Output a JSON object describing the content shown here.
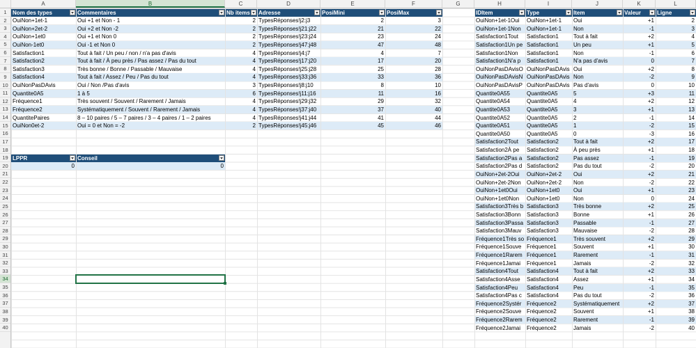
{
  "columns": [
    "A",
    "B",
    "C",
    "D",
    "E",
    "F",
    "G",
    "H",
    "I",
    "J",
    "K",
    "L"
  ],
  "rows": [
    "1",
    "2",
    "3",
    "4",
    "5",
    "6",
    "7",
    "8",
    "9",
    "10",
    "11",
    "12",
    "13",
    "14",
    "15",
    "16",
    "17",
    "18",
    "19",
    "20",
    "21",
    "22",
    "23",
    "24",
    "25",
    "26",
    "27",
    "28",
    "29",
    "30",
    "31",
    "32",
    "33",
    "34",
    "35",
    "36",
    "37",
    "38",
    "39",
    "40"
  ],
  "selected": {
    "column": "B",
    "row": "34"
  },
  "table1": {
    "headers": [
      "Nom des types",
      "Commentaires",
      "Nb items",
      "Adresse",
      "PosiMini",
      "PosiMax"
    ],
    "rows": [
      [
        "OuiNon+1et-1",
        "Oui +1 et Non - 1",
        "2",
        "TypesRéponses!j2:j3",
        "2",
        "3"
      ],
      [
        "OuiNon+2et-2",
        "Oui +2 et Non -2",
        "2",
        "TypesRéponses!j21:j22",
        "21",
        "22"
      ],
      [
        "OuiNon+1et0",
        "Oui +1 et Non 0",
        "2",
        "TypesRéponses!j23:j24",
        "23",
        "24"
      ],
      [
        "OuiNon-1et0",
        "Oui -1 et Non 0",
        "2",
        "TypesRéponses!j47:j48",
        "47",
        "48"
      ],
      [
        "Satisfaction1",
        "Tout à fait / Un  peu / non / n'a pas d'avis",
        "4",
        "TypesRéponses!j4:j7",
        "4",
        "7"
      ],
      [
        "Satisfaction2",
        "Tout à fait / À peu près / Pas assez / Pas du tout",
        "4",
        "TypesRéponses!j17:j20",
        "17",
        "20"
      ],
      [
        "Satisfaction3",
        "Très bonne / Bonne / Passable / Mauvaise",
        "4",
        "TypesRéponses!j25:j28",
        "25",
        "28"
      ],
      [
        "Satisfaction4",
        "Tout à fait / Assez / Peu / Pas du tout",
        "4",
        "TypesRéponses!j33:j36",
        "33",
        "36"
      ],
      [
        "OuiNonPasDAvis",
        "Oui / Non /Pas d'avis",
        "3",
        "TypesRéponses!j8:j10",
        "8",
        "10"
      ],
      [
        "Quantite0A5",
        "1 à 5",
        "6",
        "TypesRéponses!j11:j16",
        "11",
        "16"
      ],
      [
        "Fréquence1",
        "Très souvent / Souvent / Rarement / Jamais",
        "4",
        "TypesRéponses!j29:j32",
        "29",
        "32"
      ],
      [
        "Fréquence2",
        "Systématiquement / Souvent / Rarement / Jamais",
        "4",
        "TypesRéponses!j37:j40",
        "37",
        "40"
      ],
      [
        "QuantitePaires",
        "8 – 10 paires / 5 – 7 paires / 3 – 4 paires / 1 – 2 paires",
        "4",
        "TypesRéponses!j41:j44",
        "41",
        "44"
      ],
      [
        "OuiNon0et-2",
        "Oui = 0 et Non = -2",
        "2",
        "TypesRéponses!j45:j46",
        "45",
        "46"
      ]
    ]
  },
  "table2": {
    "headers": [
      "LPPR",
      "Conseil"
    ],
    "rows": [
      [
        "0",
        "0"
      ]
    ]
  },
  "table3": {
    "headers": [
      "IDItem",
      "Type",
      "Item",
      "Valeur",
      "Ligne"
    ],
    "rows": [
      [
        "OuiNon+1et-1Oui",
        "OuiNon+1et-1",
        "Oui",
        "+1",
        "2"
      ],
      [
        "OuiNon+1et-1Non",
        "OuiNon+1et-1",
        "Non",
        "-1",
        "3"
      ],
      [
        "Satisfaction1Tout",
        "Satisfaction1",
        "Tout à fait",
        "+2",
        "4"
      ],
      [
        "Satisfaction1Un pe",
        "Satisfaction1",
        "Un peu",
        "+1",
        "5"
      ],
      [
        "Satisfaction1Non",
        "Satisfaction1",
        "Non",
        "-1",
        "6"
      ],
      [
        "Satisfaction1N'a p",
        "Satisfaction1",
        "N'a pas d'avis",
        "0",
        "7"
      ],
      [
        "OuiNonPasDAvisO",
        "OuiNonPasDAvis",
        "Oui",
        "+2",
        "8"
      ],
      [
        "OuiNonPasDAvisN",
        "OuiNonPasDAvis",
        "Non",
        "-2",
        "9"
      ],
      [
        "OuiNonPasDAvisP",
        "OuiNonPasDAvis",
        "Pas d'avis",
        "0",
        "10"
      ],
      [
        "Quantite0A55",
        "Quantite0A5",
        "5",
        "+3",
        "11"
      ],
      [
        "Quantite0A54",
        "Quantite0A5",
        "4",
        "+2",
        "12"
      ],
      [
        "Quantite0A53",
        "Quantite0A5",
        "3",
        "+1",
        "13"
      ],
      [
        "Quantite0A52",
        "Quantite0A5",
        "2",
        "-1",
        "14"
      ],
      [
        "Quantite0A51",
        "Quantite0A5",
        "1",
        "-2",
        "15"
      ],
      [
        "Quantite0A50",
        "Quantite0A5",
        "0",
        "-3",
        "16"
      ],
      [
        "Satisfaction2Tout",
        "Satisfaction2",
        "Tout à fait",
        "+2",
        "17"
      ],
      [
        "Satisfaction2À pe",
        "Satisfaction2",
        "À peu près",
        "+1",
        "18"
      ],
      [
        "Satisfaction2Pas a",
        "Satisfaction2",
        "Pas assez",
        "-1",
        "19"
      ],
      [
        "Satisfaction2Pas d",
        "Satisfaction2",
        "Pas du tout",
        "-2",
        "20"
      ],
      [
        "OuiNon+2et-2Oui",
        "OuiNon+2et-2",
        "Oui",
        "+2",
        "21"
      ],
      [
        "OuiNon+2et-2Non",
        "OuiNon+2et-2",
        "Non",
        "-2",
        "22"
      ],
      [
        "OuiNon+1et0Oui",
        "OuiNon+1et0",
        "Oui",
        "+1",
        "23"
      ],
      [
        "OuiNon+1et0Non",
        "OuiNon+1et0",
        "Non",
        "0",
        "24"
      ],
      [
        "Satisfaction3Très b",
        "Satisfaction3",
        "Très bonne",
        "+2",
        "25"
      ],
      [
        "Satisfaction3Bonn",
        "Satisfaction3",
        "Bonne",
        "+1",
        "26"
      ],
      [
        "Satisfaction3Passa",
        "Satisfaction3",
        "Passable",
        "-1",
        "27"
      ],
      [
        "Satisfaction3Mauv",
        "Satisfaction3",
        "Mauvaise",
        "-2",
        "28"
      ],
      [
        "Fréquence1Très so",
        "Fréquence1",
        "Très souvent",
        "+2",
        "29"
      ],
      [
        "Fréquence1Souve",
        "Fréquence1",
        "Souvent",
        "+1",
        "30"
      ],
      [
        "Fréquence1Rarem",
        "Fréquence1",
        "Rarement",
        "-1",
        "31"
      ],
      [
        "Fréquence1Jamai",
        "Fréquence1",
        "Jamais",
        "-2",
        "32"
      ],
      [
        "Satisfaction4Tout",
        "Satisfaction4",
        "Tout à fait",
        "+2",
        "33"
      ],
      [
        "Satisfaction4Asse",
        "Satisfaction4",
        "Assez",
        "+1",
        "34"
      ],
      [
        "Satisfaction4Peu",
        "Satisfaction4",
        "Peu",
        "-1",
        "35"
      ],
      [
        "Satisfaction4Pas c",
        "Satisfaction4",
        "Pas du tout",
        "-2",
        "36"
      ],
      [
        "Fréquence2Systér",
        "Fréquence2",
        "Systématiquement",
        "+2",
        "37"
      ],
      [
        "Fréquence2Souve",
        "Fréquence2",
        "Souvent",
        "+1",
        "38"
      ],
      [
        "Fréquence2Rarem",
        "Fréquence2",
        "Rarement",
        "-1",
        "39"
      ],
      [
        "Fréquence2Jamai",
        "Fréquence2",
        "Jamais",
        "-2",
        "40"
      ]
    ]
  },
  "colors": {
    "header": "#1f4e79",
    "band": "#ddebf7",
    "select": "#217346"
  }
}
